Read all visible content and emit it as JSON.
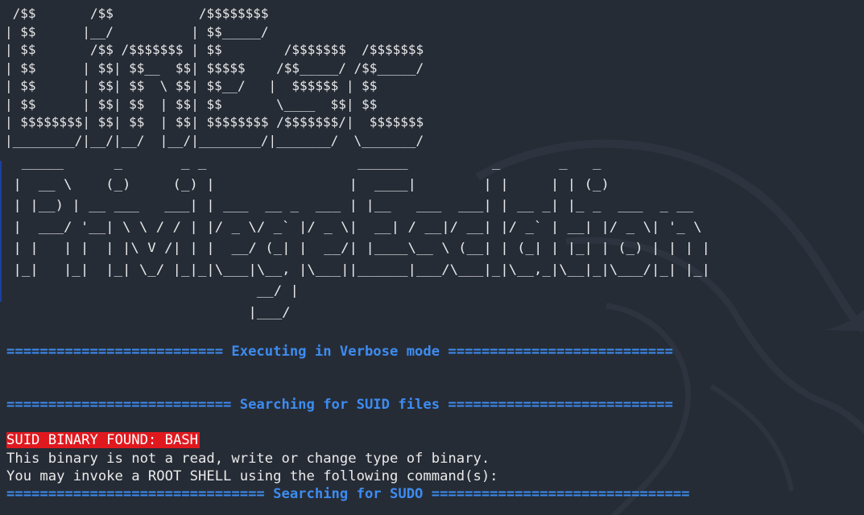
{
  "terminal": {
    "ascii_logo_unix": " /$$       /$$           /$$$$$$$$\n| $$      |__/          | $$_____/\n| $$       /$$ /$$$$$$$ | $$        /$$$$$$$  /$$$$$$$\n| $$      | $$| $$__  $$| $$$$$    /$$_____/ /$$_____/\n| $$      | $$| $$  \\ $$| $$__/   |  $$$$$$ | $$\n| $$      | $$| $$  | $$| $$       \\____  $$| $$\n| $$$$$$$$| $$| $$  | $$| $$$$$$$$ /$$$$$$$/|  $$$$$$$\n|________/|__/|__/  |__/|________/|_______/  \\_______/",
    "ascii_logo_privesc": "  _____      _       _ _                  ______          _       _   _\n |  __ \\    (_)     (_) |                |  ____|        | |     | | (_)\n | |__) | __ ___   ___| | ___  __ _  ___ | |__   ___  ___| | __ _| |_ _  ___  _ __\n |  ___/ '__| \\ \\ / / | |/ _ \\/ _` |/ _ \\|  __| / __|/ __| |/ _` | __| |/ _ \\| '_ \\\n | |   | |  | |\\ V /| | |  __/ (_| |  __/| |____\\__ \\ (__| | (_| | |_| | (_) | | | |\n |_|   |_|  |_| \\_/ |_|_|\\___|\\__, |\\___||______|___/\\___|_|\\__,_|\\__|_|\\___/|_| |_|\n                              __/ |\n                             |___/",
    "banner_verbose": "========================== Executing in Verbose mode ===========================",
    "banner_suid": "=========================== Searching for SUID files ===========================",
    "suid_found": "SUID BINARY FOUND: BASH",
    "info_line_1": "This binary is not a read, write or change type of binary.",
    "info_line_2": "You may invoke a ROOT SHELL using the following command(s):",
    "banner_sudo": "=============================== Searching for SUDO ==============================="
  },
  "colors": {
    "background": "#262c36",
    "banner_text": "#3d8cf0",
    "alert_background": "#e0191f",
    "plain_text": "#eaeaea"
  },
  "icons": {
    "background": "kali-dragon-icon"
  }
}
